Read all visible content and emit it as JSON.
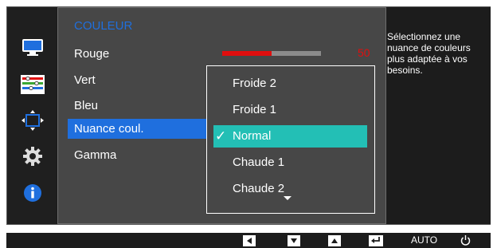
{
  "sidebar": {
    "icons": [
      {
        "name": "picture-icon"
      },
      {
        "name": "color-settings-icon"
      },
      {
        "name": "size-position-icon"
      },
      {
        "name": "setup-icon"
      },
      {
        "name": "information-icon"
      }
    ]
  },
  "menu": {
    "title": "COULEUR",
    "items": [
      {
        "label": "Rouge"
      },
      {
        "label": "Vert"
      },
      {
        "label": "Bleu"
      },
      {
        "label": "Nuance coul."
      },
      {
        "label": "Gamma"
      }
    ],
    "selected_index": 3,
    "red_slider": {
      "value": "50",
      "fraction": 0.5
    }
  },
  "dropdown": {
    "options": [
      "Froide 2",
      "Froide 1",
      "Normal",
      "Chaude 1",
      "Chaude 2"
    ],
    "selected": "Normal",
    "checkmark": "✓"
  },
  "help": {
    "text": "Sélectionnez une nuance de couleurs plus adaptée à vos besoins."
  },
  "bottom_bar": {
    "buttons": [
      {
        "name": "left-button",
        "icon": "left-arrow-icon"
      },
      {
        "name": "down-button",
        "icon": "down-arrow-icon"
      },
      {
        "name": "up-button",
        "icon": "up-arrow-icon"
      },
      {
        "name": "enter-button",
        "icon": "enter-icon"
      },
      {
        "name": "auto-button",
        "label": "AUTO"
      },
      {
        "name": "power-button",
        "icon": "power-icon"
      }
    ]
  },
  "colors": {
    "accent": "#1f6fde",
    "selected_option": "#23bfb5",
    "slider_red": "#e00e0e"
  }
}
